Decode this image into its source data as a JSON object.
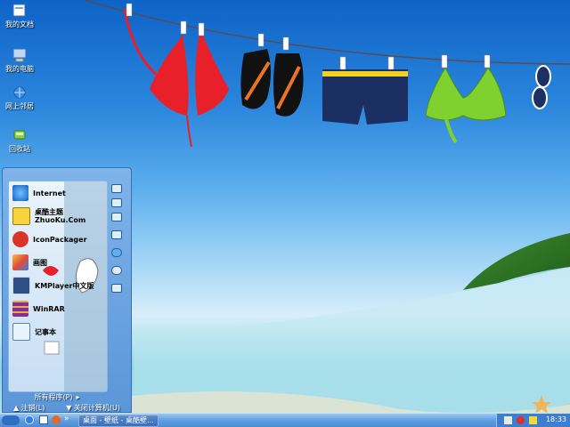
{
  "desktop_icons": [
    {
      "label": "我的文档",
      "icon": "my-documents-icon"
    },
    {
      "label": "我的电脑",
      "icon": "my-computer-icon"
    },
    {
      "label": "网上邻居",
      "icon": "network-icon"
    },
    {
      "label": "回收站",
      "icon": "recycle-bin-icon"
    }
  ],
  "start_menu": {
    "pinned": [
      {
        "label": "Internet",
        "icon": "internet-explorer-icon"
      },
      {
        "label": "桌酷主题\nZhuoKu.Com",
        "icon": "zhuoku-icon"
      },
      {
        "label": "IconPackager",
        "icon": "iconpackager-icon"
      },
      {
        "label": "画图",
        "icon": "paint-icon"
      },
      {
        "label": "KMPlayer中文版",
        "icon": "kmplayer-icon"
      },
      {
        "label": "WinRAR",
        "icon": "winrar-icon"
      },
      {
        "label": "记事本",
        "icon": "notepad-icon"
      }
    ],
    "all_programs": "所有程序(P)",
    "logoff": "注销(L)",
    "shutdown": "关闭计算机(U)"
  },
  "taskbar": {
    "quicklaunch_more": "»",
    "task_label": "桌面 - 壁纸 - 桌酷壁...",
    "clock": "18:33"
  },
  "colors": {
    "bikini": "#e8202a",
    "swim_trunks": "#1b2f62",
    "green_top": "#7ed12e",
    "taskbar": "#4a8bd4"
  }
}
